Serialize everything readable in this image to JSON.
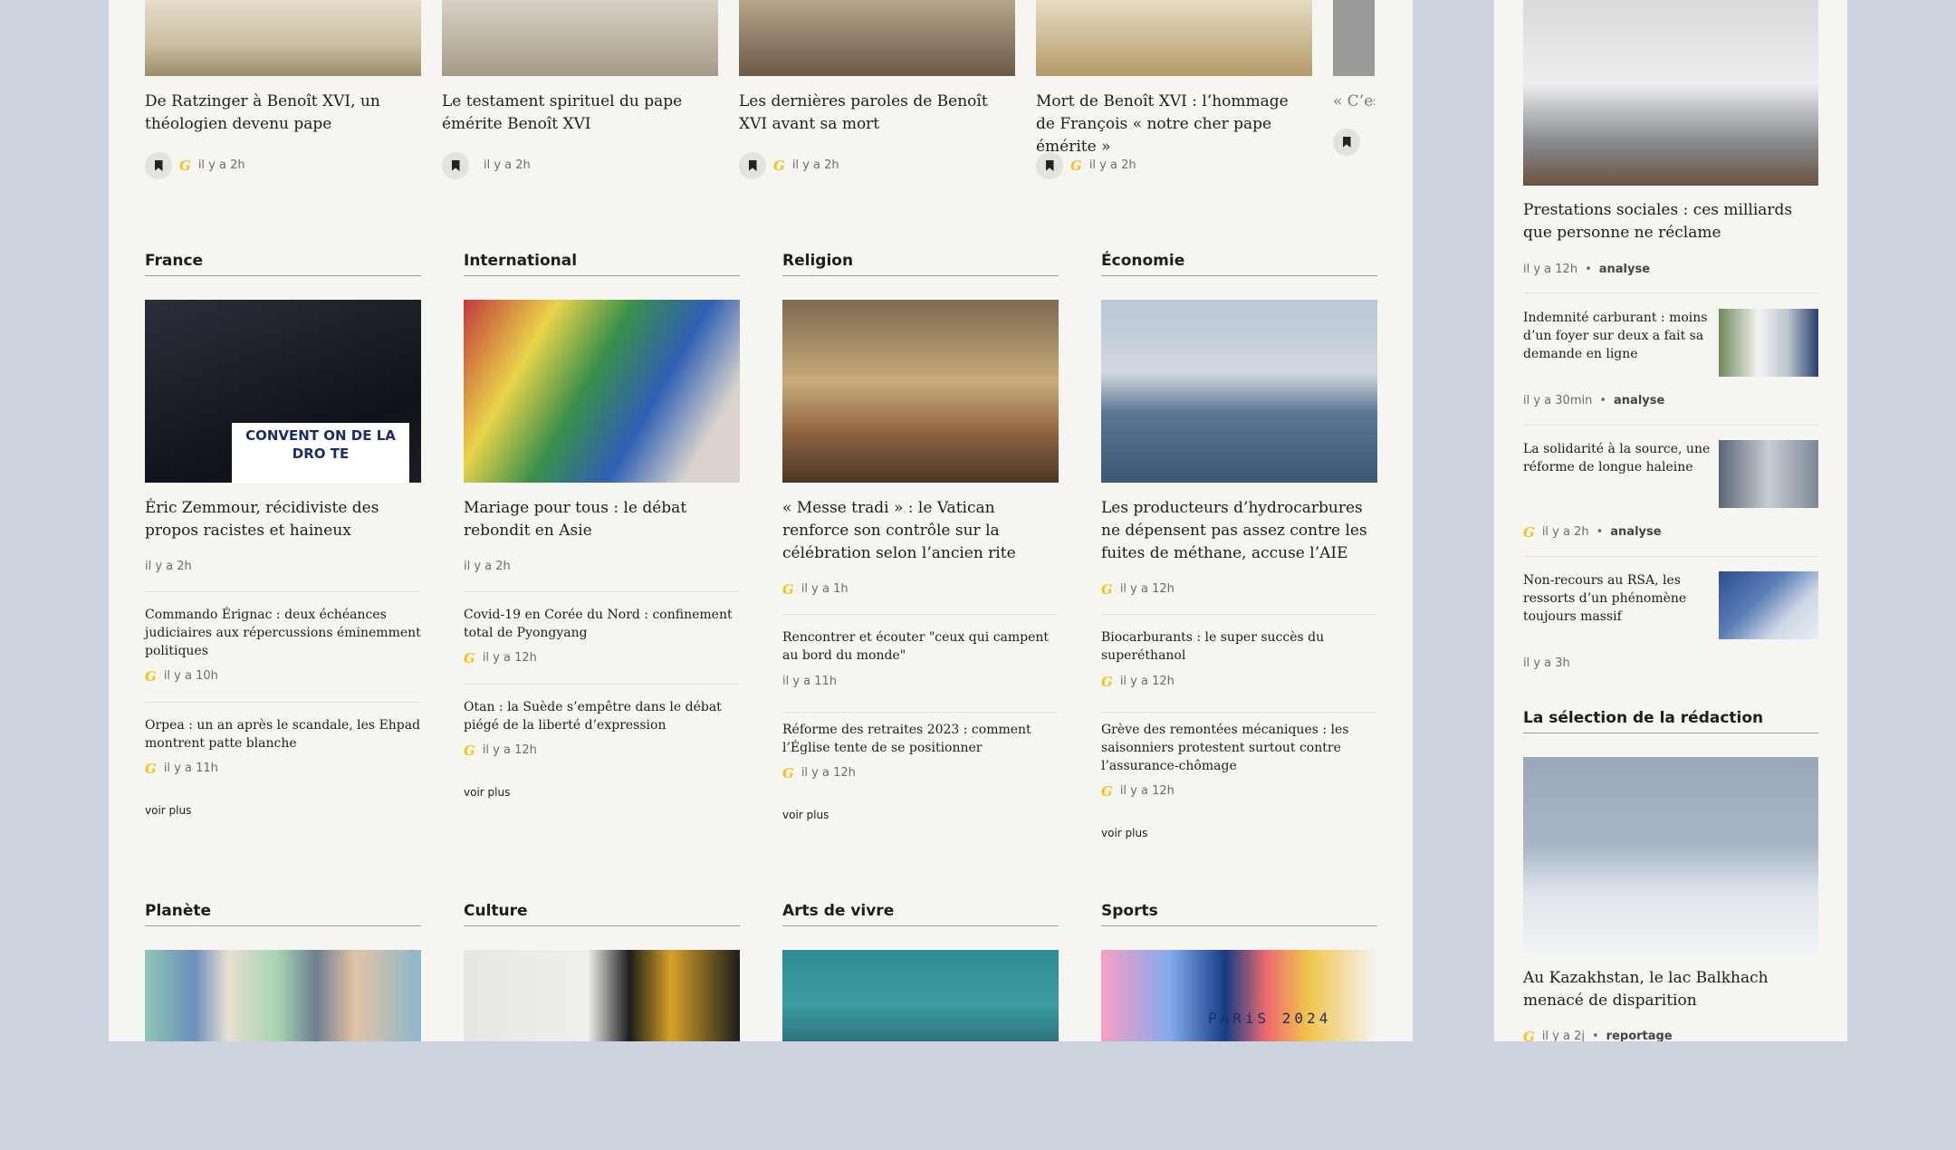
{
  "carousel": [
    {
      "title": "De Ratzinger à Benoît XVI, un théologien devenu pape",
      "time": "il y a 2h"
    },
    {
      "title": "Le testament spirituel du pape émérite Benoît XVI",
      "time": "il y a 2h"
    },
    {
      "title": "Les dernières paroles de Benoît XVI avant sa mort",
      "time": "il y a 2h"
    },
    {
      "title": "Mort de Benoît XVI : l’hommage de François « notre cher pape émérite »",
      "time": "il y a 2h"
    },
    {
      "title": "« C’es"
    }
  ],
  "premium_badge": "G",
  "sections": {
    "france": {
      "heading": "France",
      "lead": {
        "title": "Éric Zemmour, récidiviste des propos racistes et haineux",
        "time": "il y a 2h",
        "image_sign": "CONVENT ON DE LA DRO TE"
      },
      "items": [
        {
          "title": "Commando Érignac : deux échéances judiciaires aux répercussions éminemment politiques",
          "time": "il y a 10h"
        },
        {
          "title": "Orpea : un an après le scandale, les Ehpad montrent patte blanche",
          "time": "il y a 11h"
        }
      ],
      "more": "voir plus"
    },
    "international": {
      "heading": "International",
      "lead": {
        "title": "Mariage pour tous : le débat rebondit en Asie",
        "time": "il y a 2h"
      },
      "items": [
        {
          "title": "Covid-19 en Corée du Nord : confinement total de Pyongyang",
          "time": "il y a 12h"
        },
        {
          "title": "Otan : la Suède s’empêtre dans le débat piégé de la liberté d’expression",
          "time": "il y a 12h"
        }
      ],
      "more": "voir plus"
    },
    "religion": {
      "heading": "Religion",
      "lead": {
        "title": "« Messe tradi » : le Vatican renforce son contrôle sur la célébration selon l’ancien rite",
        "time": "il y a 1h"
      },
      "items": [
        {
          "title": "Rencontrer et écouter \"ceux qui campent au bord du monde\"",
          "time": "il y a 11h"
        },
        {
          "title": "Réforme des retraites 2023 : comment l’Église tente de se positionner",
          "time": "il y a 12h"
        }
      ],
      "more": "voir plus"
    },
    "economie": {
      "heading": "Économie",
      "lead": {
        "title": "Les producteurs d’hydrocarbures ne dépensent pas assez contre les fuites de méthane, accuse l’AIE",
        "time": "il y a 12h"
      },
      "items": [
        {
          "title": "Biocarburants : le super succès du superéthanol",
          "time": "il y a 12h"
        },
        {
          "title": "Grève des remontées mécaniques : les saisonniers protestent surtout contre l’assurance-chômage",
          "time": "il y a 12h"
        }
      ],
      "more": "voir plus"
    }
  },
  "lower_sections": [
    "Planète",
    "Culture",
    "Arts de vivre",
    "Sports"
  ],
  "paris_text": "PARiS 2024",
  "sidebar": {
    "lead": {
      "title": "Prestations sociales : ces milliards que personne ne réclame",
      "time": "il y a 12h",
      "tag": "analyse"
    },
    "items": [
      {
        "title": "Indemnité carburant : moins d’un foyer sur deux a fait sa demande en ligne",
        "time": "il y a 30min",
        "tag": "analyse"
      },
      {
        "title": "La solidarité à la source, une réforme de longue haleine",
        "time": "il y a 2h",
        "tag": "analyse"
      },
      {
        "title": "Non-recours au RSA, les ressorts d’un phénomène toujours massif",
        "time": "il y a 3h"
      }
    ],
    "selection": {
      "heading": "La sélection de la rédaction",
      "title": "Au Kazakhstan, le lac Balkhach menacé de disparition",
      "time": "il y a 2j",
      "tag": "reportage"
    }
  }
}
